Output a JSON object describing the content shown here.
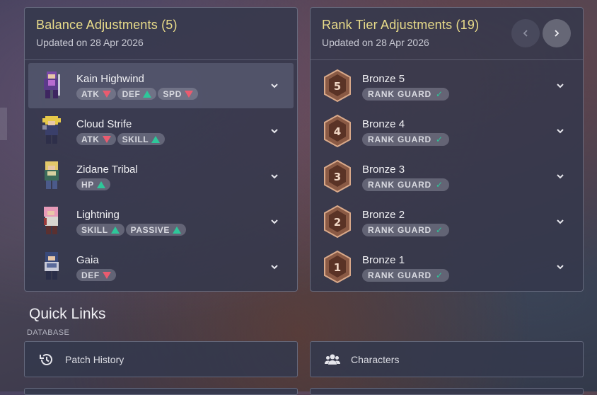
{
  "balance": {
    "title": "Balance Adjustments (5)",
    "updated": "Updated on 28 Apr 2026",
    "items": [
      {
        "name": "Kain Highwind",
        "tags": [
          {
            "label": "ATK",
            "dir": "down"
          },
          {
            "label": "DEF",
            "dir": "up"
          },
          {
            "label": "SPD",
            "dir": "down"
          }
        ]
      },
      {
        "name": "Cloud Strife",
        "tags": [
          {
            "label": "ATK",
            "dir": "down"
          },
          {
            "label": "SKILL",
            "dir": "up"
          }
        ]
      },
      {
        "name": "Zidane Tribal",
        "tags": [
          {
            "label": "HP",
            "dir": "up"
          }
        ]
      },
      {
        "name": "Lightning",
        "tags": [
          {
            "label": "SKILL",
            "dir": "up"
          },
          {
            "label": "PASSIVE",
            "dir": "up"
          }
        ]
      },
      {
        "name": "Gaia",
        "tags": [
          {
            "label": "DEF",
            "dir": "down"
          }
        ]
      }
    ]
  },
  "ranks": {
    "title": "Rank Tier Adjustments (19)",
    "updated": "Updated on 28 Apr 2026",
    "items": [
      {
        "name": "Bronze 5",
        "numeral": "5",
        "badge": "RANK GUARD"
      },
      {
        "name": "Bronze 4",
        "numeral": "4",
        "badge": "RANK GUARD"
      },
      {
        "name": "Bronze 3",
        "numeral": "3",
        "badge": "RANK GUARD"
      },
      {
        "name": "Bronze 2",
        "numeral": "2",
        "badge": "RANK GUARD"
      },
      {
        "name": "Bronze 1",
        "numeral": "1",
        "badge": "RANK GUARD"
      }
    ]
  },
  "quick_links": {
    "title": "Quick Links",
    "category": "DATABASE",
    "links": [
      {
        "label": "Patch History",
        "icon": "history-icon"
      },
      {
        "label": "Characters",
        "icon": "users-icon"
      }
    ]
  },
  "colors": {
    "accent_title": "#e9dc8a",
    "up": "#2ec79a",
    "down": "#ea5b6f"
  }
}
